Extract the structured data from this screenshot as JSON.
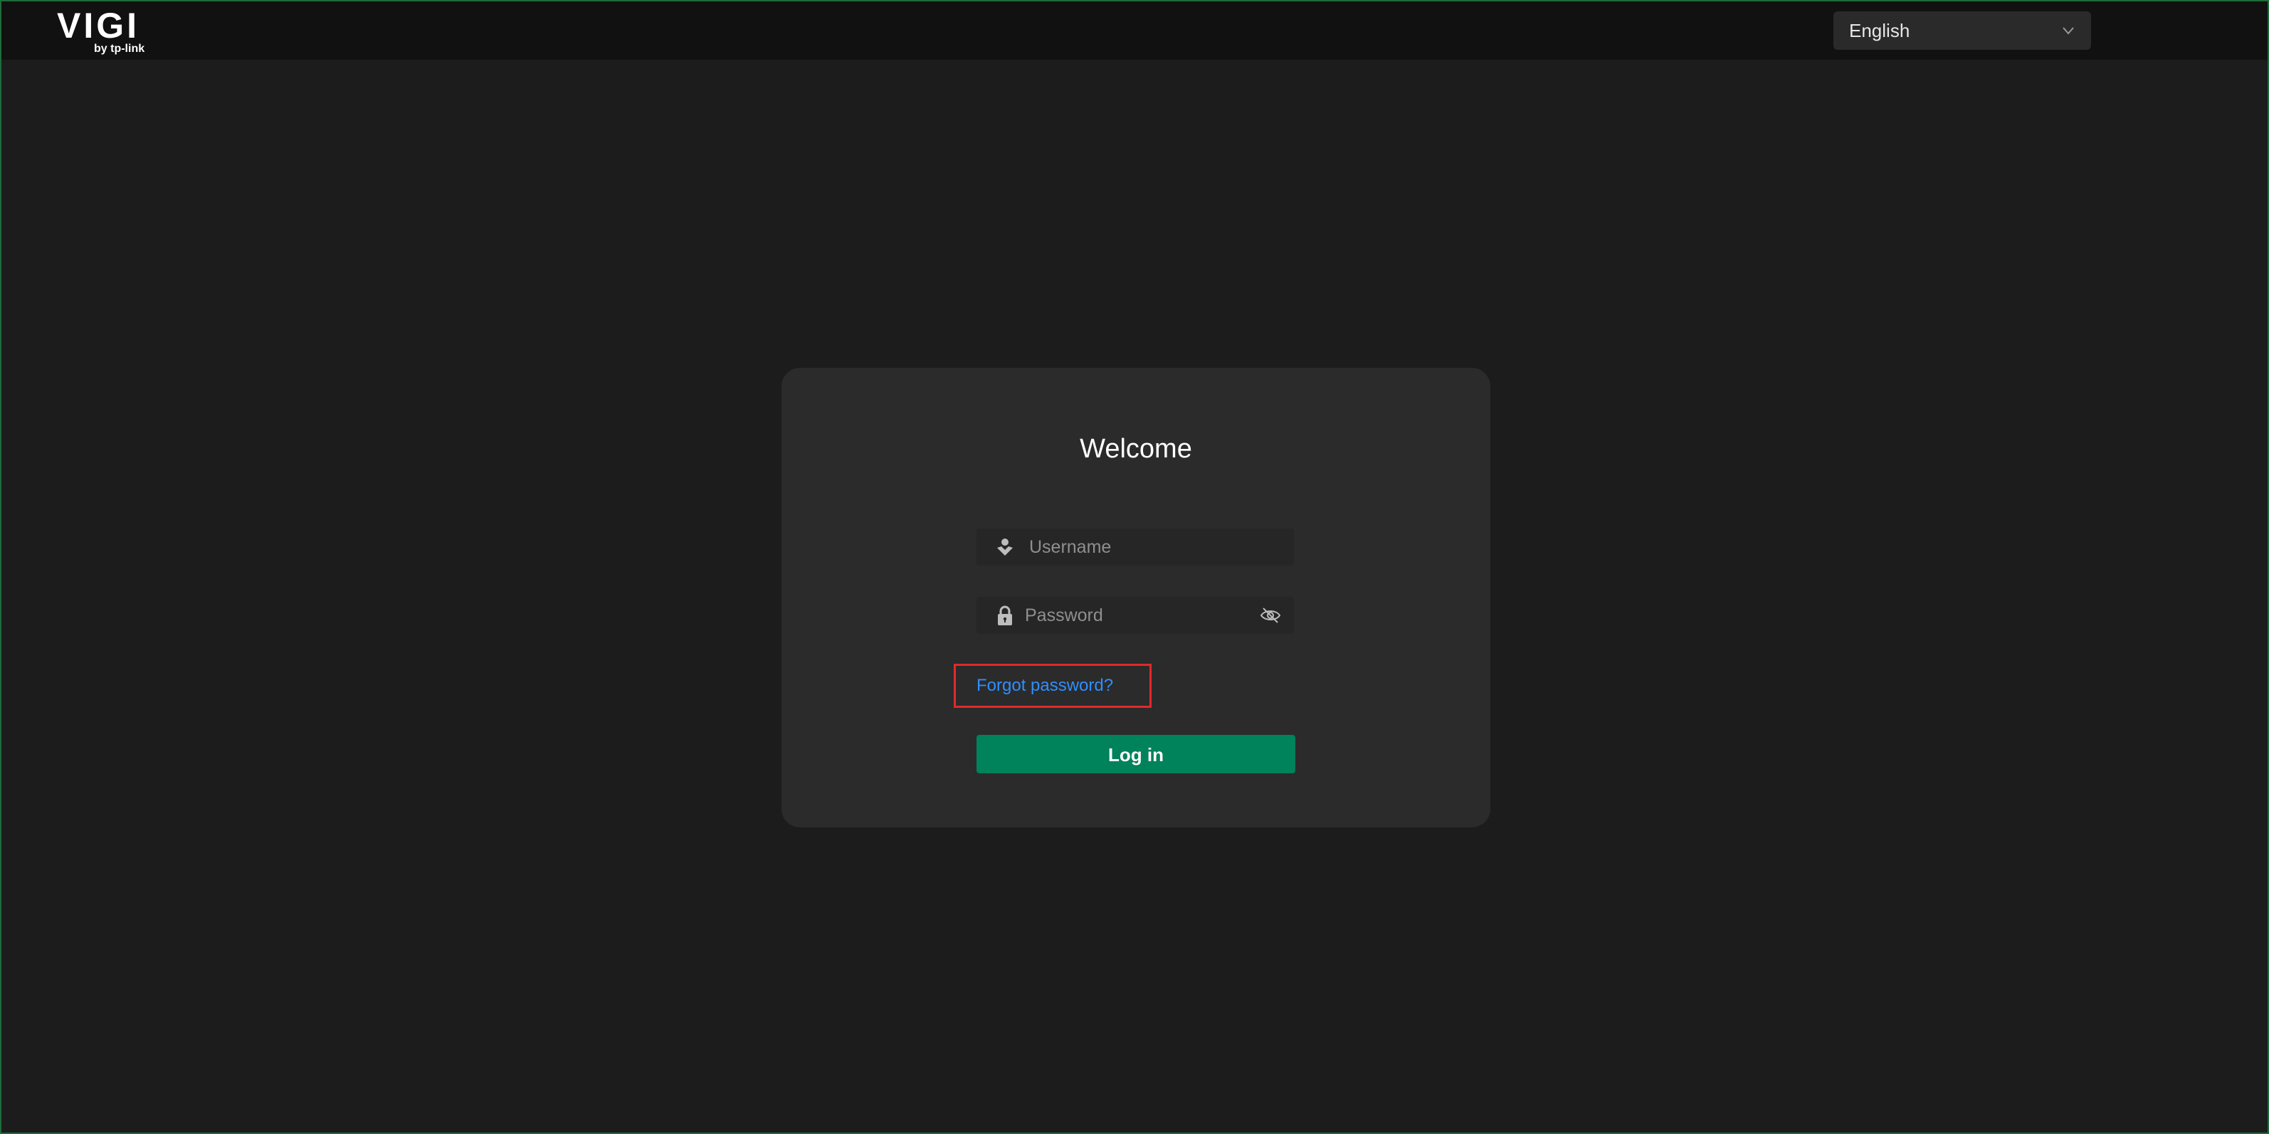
{
  "header": {
    "logo_text": "VIGI",
    "logo_subtext": "by tp-link",
    "language": {
      "selected": "English",
      "icon": "chevron-down-icon"
    }
  },
  "login": {
    "title": "Welcome",
    "username": {
      "placeholder": "Username",
      "value": "",
      "icon": "user-icon"
    },
    "password": {
      "placeholder": "Password",
      "value": "",
      "icon": "lock-icon",
      "toggle_icon": "eye-off-icon"
    },
    "forgot_label": "Forgot password?",
    "login_label": "Log in"
  },
  "colors": {
    "background": "#1c1c1c",
    "topbar": "#111111",
    "card": "#2b2b2b",
    "accent": "#00825a",
    "link": "#2f8fff",
    "highlight_border": "#e02a2a"
  }
}
